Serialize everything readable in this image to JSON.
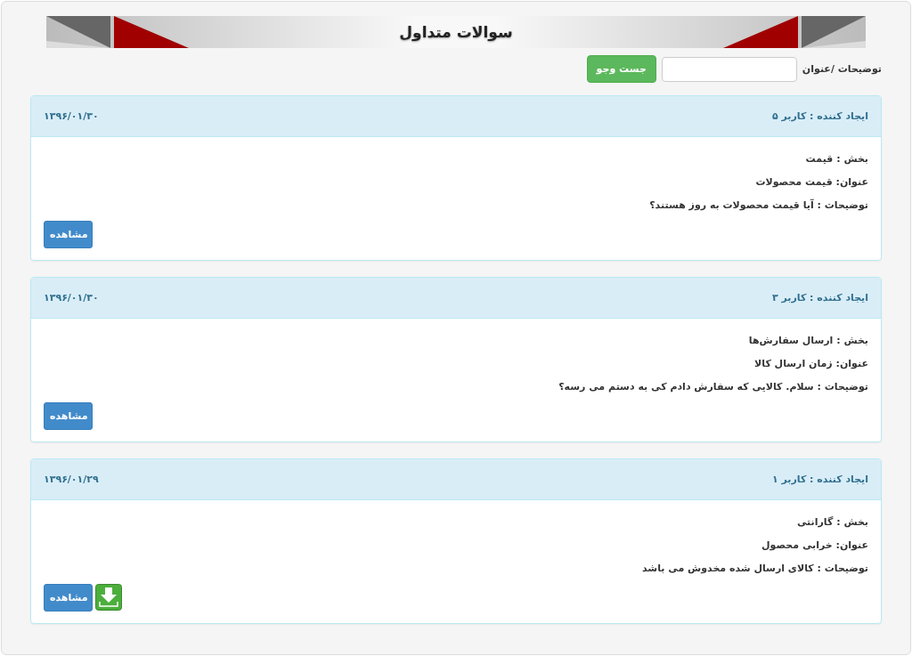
{
  "title": "سوالات متداول",
  "search": {
    "label": "توضیحات /عنوان",
    "button": "جست وجو"
  },
  "questions": [
    {
      "creator": "ایجاد کننده : کاربر ۵",
      "date": "۱۳۹۶/۰۱/۳۰",
      "section": "بخش : قیمت",
      "subject": "عنوان: قیمت محصولات",
      "description": "توضیحات : آیا قیمت محصولات به روز هستند؟",
      "button": "مشاهده",
      "download": false
    },
    {
      "creator": "ایجاد کننده : کاربر ۳",
      "date": "۱۳۹۶/۰۱/۳۰",
      "section": "بخش : ارسال سفارش‌ها",
      "subject": "عنوان: زمان ارسال کالا",
      "description": "توضیحات : سلام. کالایی که سفارش دادم کی به دستم می رسه؟",
      "button": "مشاهده",
      "download": false
    },
    {
      "creator": "ایجاد کننده : کاربر ۱",
      "date": "۱۳۹۶/۰۱/۲۹",
      "section": "بخش : گارانتی",
      "subject": "عنوان: خرابی محصول",
      "description": "توضیحات : کالای ارسال شده مخدوش می باشد",
      "button": "مشاهده",
      "download": true
    }
  ]
}
